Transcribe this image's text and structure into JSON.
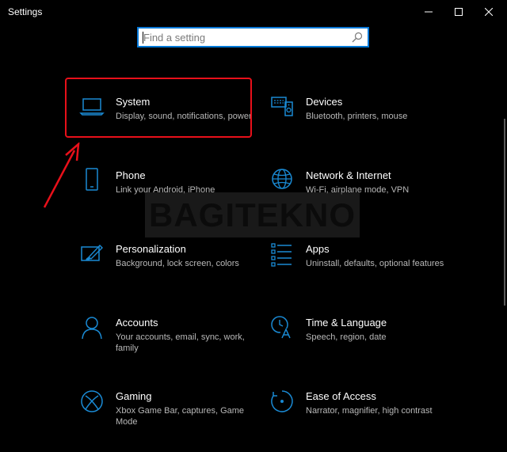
{
  "window": {
    "title": "Settings",
    "controls": [
      "minimize-icon",
      "maximize-icon",
      "close-icon"
    ]
  },
  "search": {
    "placeholder": "Find a setting",
    "icon": "search-icon"
  },
  "colors": {
    "accent": "#0078d7",
    "highlight": "#e8101a",
    "background": "#000000",
    "description": "#b8b8b8"
  },
  "categories": [
    {
      "title": "System",
      "description": "Display, sound, notifications, power",
      "icon": "laptop-icon"
    },
    {
      "title": "Devices",
      "description": "Bluetooth, printers, mouse",
      "icon": "devices-icon"
    },
    {
      "title": "Phone",
      "description": "Link your Android, iPhone",
      "icon": "phone-icon"
    },
    {
      "title": "Network & Internet",
      "description": "Wi-Fi, airplane mode, VPN",
      "icon": "globe-icon"
    },
    {
      "title": "Personalization",
      "description": "Background, lock screen, colors",
      "icon": "personalization-icon"
    },
    {
      "title": "Apps",
      "description": "Uninstall, defaults, optional features",
      "icon": "apps-list-icon"
    },
    {
      "title": "Accounts",
      "description": "Your accounts, email, sync, work, family",
      "icon": "person-icon"
    },
    {
      "title": "Time & Language",
      "description": "Speech, region, date",
      "icon": "time-language-icon"
    },
    {
      "title": "Gaming",
      "description": "Xbox Game Bar, captures, Game Mode",
      "icon": "xbox-icon"
    },
    {
      "title": "Ease of Access",
      "description": "Narrator, magnifier, high contrast",
      "icon": "ease-of-access-icon"
    }
  ],
  "watermark": "BAGITEKNO"
}
